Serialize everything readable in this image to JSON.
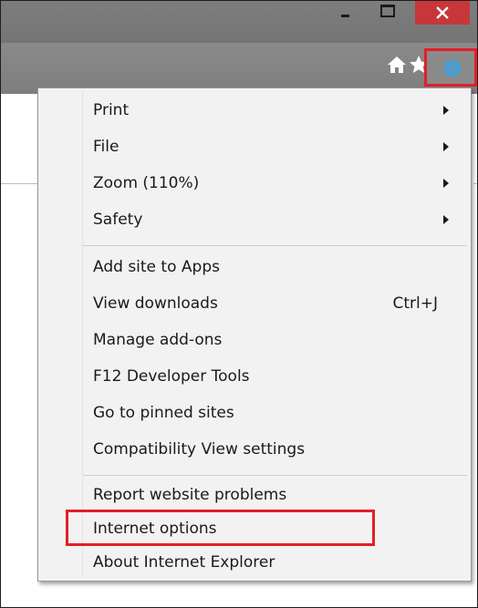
{
  "window": {
    "minimize_icon": "minimize-icon",
    "maximize_icon": "maximize-icon",
    "close_icon": "close-icon",
    "close_color": "#c7373a"
  },
  "toolbar": {
    "icons": [
      "home-icon",
      "star-icon",
      "gear-icon"
    ],
    "gear_color": "#3da2e0",
    "highlight_color": "#e41e26"
  },
  "menu": {
    "groups": [
      [
        {
          "label": "Print",
          "submenu": true
        },
        {
          "label": "File",
          "submenu": true
        },
        {
          "label": "Zoom (110%)",
          "submenu": true
        },
        {
          "label": "Safety",
          "submenu": true
        }
      ],
      [
        {
          "label": "Add site to Apps"
        },
        {
          "label": "View downloads",
          "shortcut": "Ctrl+J"
        },
        {
          "label": "Manage add-ons"
        },
        {
          "label": "F12 Developer Tools"
        },
        {
          "label": "Go to pinned sites"
        },
        {
          "label": "Compatibility View settings"
        }
      ],
      [
        {
          "label": "Report website problems"
        },
        {
          "label": "Internet options",
          "highlighted": true
        },
        {
          "label": "About Internet Explorer"
        }
      ]
    ]
  }
}
